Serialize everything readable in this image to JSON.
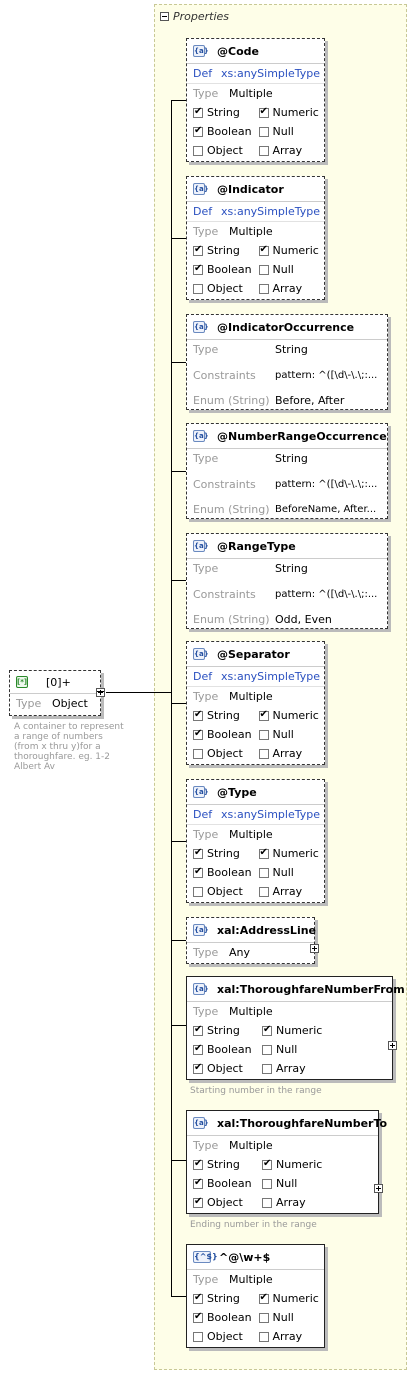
{
  "panel": {
    "title": "Properties"
  },
  "root": {
    "label": "[0]+",
    "type_label": "Type",
    "type_value": "Object",
    "description": "A container to represent a range of numbers (from x thru y)for a thoroughfare. eg. 1-2 Albert Av"
  },
  "labels": {
    "type": "Type",
    "def": "Def",
    "constraints": "Constraints",
    "enum": "Enum (String)",
    "string": "String",
    "numeric": "Numeric",
    "boolean": "Boolean",
    "null": "Null",
    "object": "Object",
    "array": "Array"
  },
  "nodes": {
    "code": {
      "name": "@Code",
      "def": "xs:anySimpleType",
      "type": "Multiple",
      "checks": {
        "string": true,
        "numeric": true,
        "boolean": true,
        "null": false,
        "object": false,
        "array": false
      }
    },
    "indicator": {
      "name": "@Indicator",
      "def": "xs:anySimpleType",
      "type": "Multiple",
      "checks": {
        "string": true,
        "numeric": true,
        "boolean": true,
        "null": false,
        "object": false,
        "array": false
      }
    },
    "indicator_occurrence": {
      "name": "@IndicatorOccurrence",
      "type": "String",
      "constraints": "pattern: ^([\\d\\-\\.\\;:...",
      "enum": "Before, After"
    },
    "number_range_occurrence": {
      "name": "@NumberRangeOccurrence",
      "type": "String",
      "constraints": "pattern: ^([\\d\\-\\.\\;:...",
      "enum": "BeforeName, After..."
    },
    "range_type": {
      "name": "@RangeType",
      "type": "String",
      "constraints": "pattern: ^([\\d\\-\\.\\;:...",
      "enum": "Odd, Even"
    },
    "separator": {
      "name": "@Separator",
      "def": "xs:anySimpleType",
      "type": "Multiple",
      "checks": {
        "string": true,
        "numeric": true,
        "boolean": true,
        "null": false,
        "object": false,
        "array": false
      }
    },
    "type": {
      "name": "@Type",
      "def": "xs:anySimpleType",
      "type": "Multiple",
      "checks": {
        "string": true,
        "numeric": true,
        "boolean": true,
        "null": false,
        "object": false,
        "array": false
      }
    },
    "address_line": {
      "name": "xal:AddressLine",
      "type": "Any"
    },
    "from": {
      "name": "xal:ThoroughfareNumberFrom",
      "type": "Multiple",
      "note": "Starting number in the range",
      "checks": {
        "string": true,
        "numeric": true,
        "boolean": true,
        "null": false,
        "object": true,
        "array": false
      }
    },
    "to": {
      "name": "xal:ThoroughfareNumberTo",
      "type": "Multiple",
      "note": "Ending number in the range",
      "checks": {
        "string": true,
        "numeric": true,
        "boolean": true,
        "null": false,
        "object": true,
        "array": false
      }
    },
    "pattern": {
      "name": "^@\\w+$",
      "icon": "{^$}",
      "type": "Multiple",
      "checks": {
        "string": true,
        "numeric": true,
        "boolean": true,
        "null": false,
        "object": false,
        "array": false
      }
    }
  }
}
